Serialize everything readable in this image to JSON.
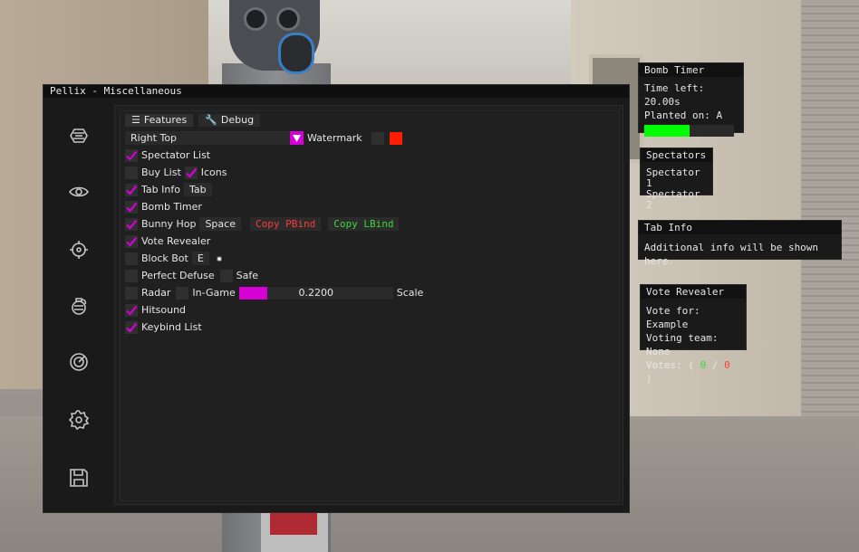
{
  "window": {
    "title": "Pellix - Miscellaneous"
  },
  "sidebar": {
    "icons": [
      "aimbot-icon",
      "eye-icon",
      "crosshair-icon",
      "grenade-icon",
      "radar-icon",
      "gear-icon",
      "save-icon"
    ]
  },
  "tabs": [
    {
      "label": "Features",
      "icon": "list-icon"
    },
    {
      "label": "Debug",
      "icon": "wrench-icon"
    }
  ],
  "watermark": {
    "position_value": "Right Top",
    "label": "Watermark",
    "checked": false,
    "color": "#ff1e00"
  },
  "features": {
    "spectator_list": {
      "label": "Spectator List",
      "checked": true
    },
    "buy_list": {
      "label": "Buy List",
      "checked": false
    },
    "icons": {
      "label": "Icons",
      "checked": true
    },
    "tab_info": {
      "label": "Tab Info",
      "checked": true,
      "key": "Tab"
    },
    "bomb_timer": {
      "label": "Bomb Timer",
      "checked": true
    },
    "bunny_hop": {
      "label": "Bunny Hop",
      "checked": true,
      "key": "Space",
      "copy_pbind": "Copy PBind",
      "copy_lbind": "Copy LBind"
    },
    "vote_revealer": {
      "label": "Vote Revealer",
      "checked": true
    },
    "block_bot": {
      "label": "Block Bot",
      "checked": false,
      "key": "E"
    },
    "perfect_defuse": {
      "label": "Perfect Defuse",
      "checked": false
    },
    "safe": {
      "label": "Safe",
      "checked": false
    },
    "radar": {
      "label": "Radar",
      "checked": false,
      "ingame_label": "In-Game",
      "ingame_checked": false,
      "scale_value": 0.22,
      "scale_text": "0.2200",
      "scale_label": "Scale"
    },
    "hitsound": {
      "label": "Hitsound",
      "checked": true
    },
    "keybind_list": {
      "label": "Keybind List",
      "checked": true
    }
  },
  "bomb_timer_panel": {
    "title": "Bomb Timer",
    "time_left": "Time left: 20.00s",
    "planted_on": "Planted on: A",
    "progress": 0.5
  },
  "spectators_panel": {
    "title": "Spectators",
    "entries": [
      "Spectator 1",
      "Spectator 2"
    ]
  },
  "tab_info_panel": {
    "title": "Tab Info",
    "text": "Additional info will be shown here."
  },
  "vote_revealer_panel": {
    "title": "Vote Revealer",
    "vote_for": "Vote for: Example",
    "voting_team": "Voting team: None",
    "votes_prefix": "Votes: (",
    "votes_yes": "0",
    "votes_sep": "/",
    "votes_no": "0",
    "votes_suffix": ")"
  },
  "colors": {
    "accent": "#d400d4",
    "progress": "#00ff00",
    "bind_red": "#ff3a3a",
    "bind_green": "#3bd93b"
  }
}
